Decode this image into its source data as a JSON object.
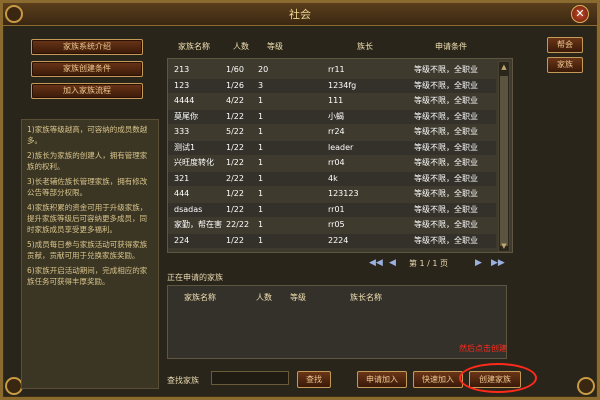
{
  "window": {
    "title": "社会"
  },
  "left": {
    "buttons": [
      "家族系统介绍",
      "家族创建条件",
      "加入家族流程"
    ],
    "info": [
      "1)家族等级越高，可容纳的成员数越多。",
      "2)族长为家族的创建人，拥有管理家族的权利。",
      "3)长老辅佐族长管理家族，拥有修改公告等部分权限。",
      "4)家族积累的资金可用于升级家族，提升家族等级后可容纳更多成员，同时家族成员享受更多福利。",
      "5)成员每日参与家族活动可获得家族贡献，贡献可用于兑换家族奖励。",
      "6)家族开启活动期间，完成相应的家族任务可获得丰厚奖励。"
    ]
  },
  "right_buttons": {
    "society": "帮会",
    "family": "家族"
  },
  "table": {
    "headers": [
      "家族名称",
      "人数",
      "等级",
      "族长",
      "申请条件"
    ],
    "rows": [
      [
        "213",
        "1/60",
        "20",
        "rr11",
        "等级不限，全职业"
      ],
      [
        "123",
        "1/26",
        "3",
        "1234fg",
        "等级不限，全职业"
      ],
      [
        "4444",
        "4/22",
        "1",
        "111",
        "等级不限，全职业"
      ],
      [
        "莫尾你",
        "1/22",
        "1",
        "小蝎",
        "等级不限，全职业"
      ],
      [
        "333",
        "5/22",
        "1",
        "rr24",
        "等级不限，全职业"
      ],
      [
        "测试1",
        "1/22",
        "1",
        "leader",
        "等级不限，全职业"
      ],
      [
        "兴旺度转化",
        "1/22",
        "1",
        "rr04",
        "等级不限，全职业"
      ],
      [
        "321",
        "2/22",
        "1",
        "4k",
        "等级不限，全职业"
      ],
      [
        "444",
        "1/22",
        "1",
        "123123",
        "等级不限，全职业"
      ],
      [
        "dsadas",
        "1/22",
        "1",
        "rr01",
        "等级不限，全职业"
      ],
      [
        "家勤，帮在害",
        "22/22",
        "1",
        "rr05",
        "等级不限，全职业"
      ],
      [
        "224",
        "1/22",
        "1",
        "2224",
        "等级不限，全职业"
      ]
    ]
  },
  "pager": {
    "text": "第 1 / 1 页"
  },
  "apply": {
    "label": "正在申请的家族",
    "headers": [
      "家族名称",
      "人数",
      "等级",
      "族长名称"
    ]
  },
  "bottom": {
    "search_label": "查找家族",
    "search_value": "",
    "search_btn": "查找",
    "apply_btn": "申请加入",
    "quick_btn": "快速加入",
    "create_btn": "创建家族"
  },
  "annotation": {
    "text": "然后点击创建"
  },
  "colors": {
    "annotation": "#ff2a1a",
    "frame": "#8a6a2e"
  }
}
